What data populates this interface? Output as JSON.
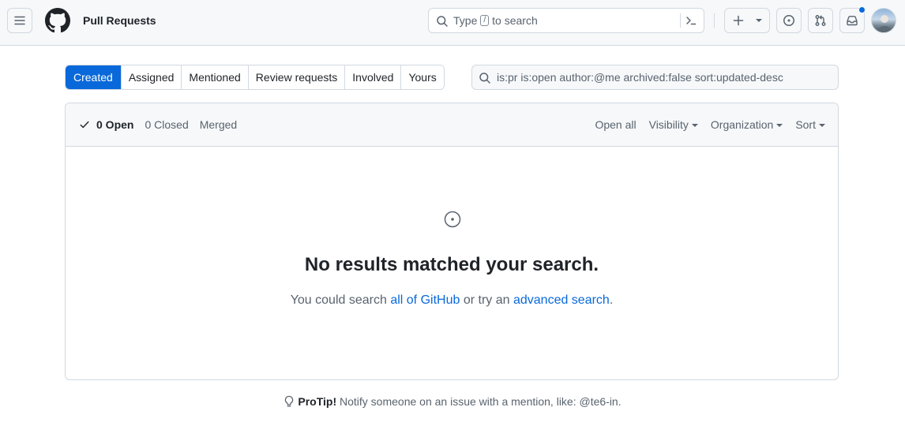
{
  "header": {
    "title": "Pull Requests",
    "search": {
      "prefix": "Type",
      "key": "/",
      "suffix": "to search"
    },
    "icons": [
      "hamburger-menu-icon",
      "github-logo-icon",
      "search-icon",
      "command-palette-icon",
      "plus-icon",
      "issue-icon",
      "pull-request-icon",
      "inbox-icon"
    ],
    "accent_color": "#0969da"
  },
  "tabs": [
    {
      "label": "Created",
      "selected": true
    },
    {
      "label": "Assigned"
    },
    {
      "label": "Mentioned"
    },
    {
      "label": "Review requests"
    },
    {
      "label": "Involved"
    },
    {
      "label": "Yours"
    }
  ],
  "filter": {
    "value": "is:pr is:open author:@me archived:false sort:updated-desc"
  },
  "states": {
    "open": "0 Open",
    "closed": "0 Closed",
    "merged": "Merged"
  },
  "filters": {
    "open_all": "Open all",
    "visibility": "Visibility",
    "organization": "Organization",
    "sort": "Sort"
  },
  "blankslate": {
    "title": "No results matched your search.",
    "text_before": "You could search",
    "link1": "all of GitHub",
    "text_middle": "or try an",
    "link2": "advanced search",
    "text_after": "."
  },
  "protip": {
    "label": "ProTip!",
    "text": "Notify someone on an issue with a mention, like: @te6-in."
  }
}
